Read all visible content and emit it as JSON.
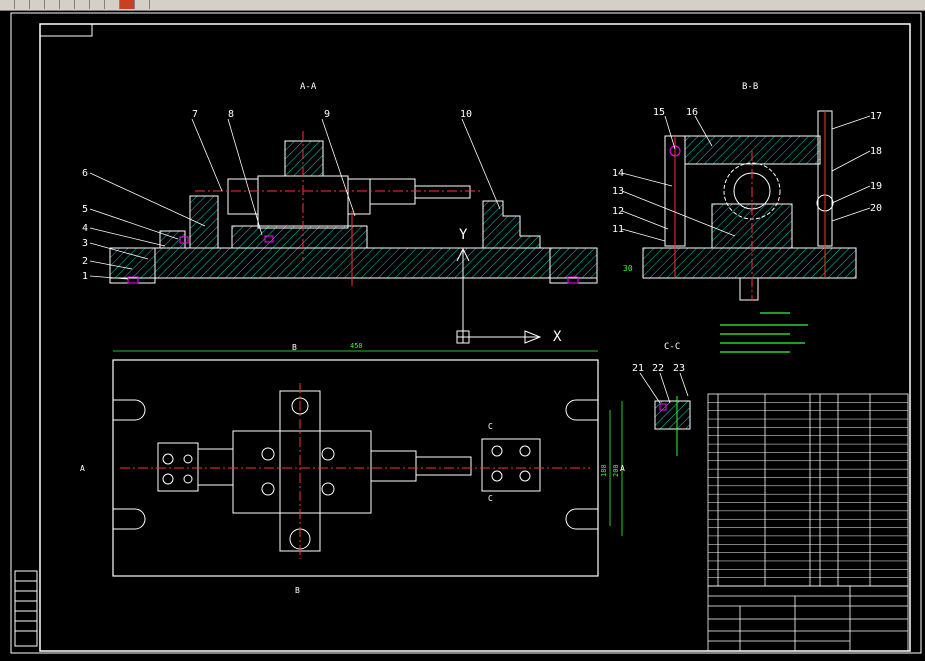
{
  "section_labels": {
    "aa": "A-A",
    "bb": "B-B",
    "cc": "C-C"
  },
  "part_numbers": [
    "1",
    "2",
    "3",
    "4",
    "5",
    "6",
    "7",
    "8",
    "9",
    "10",
    "11",
    "12",
    "13",
    "14",
    "15",
    "16",
    "17",
    "18",
    "19",
    "20",
    "21",
    "22",
    "23"
  ],
  "view_markers": {
    "a_left": "A",
    "a_right": "A",
    "b_top": "B",
    "b_bottom": "B",
    "c_top": "C",
    "c_bottom": "C"
  },
  "axes": {
    "y": "Y",
    "x": "X"
  },
  "dimensions": {
    "length": "450",
    "height_1": "180",
    "height_2": "200",
    "aa_dim": "30"
  },
  "colors": {
    "outline": "#ffffff",
    "hatch": "#00c8c8",
    "centerline": "#ff3030",
    "dimension": "#30ff30",
    "leader": "#ffffff",
    "highlight": "#ff00ff",
    "tech_note": "#30ff30"
  }
}
